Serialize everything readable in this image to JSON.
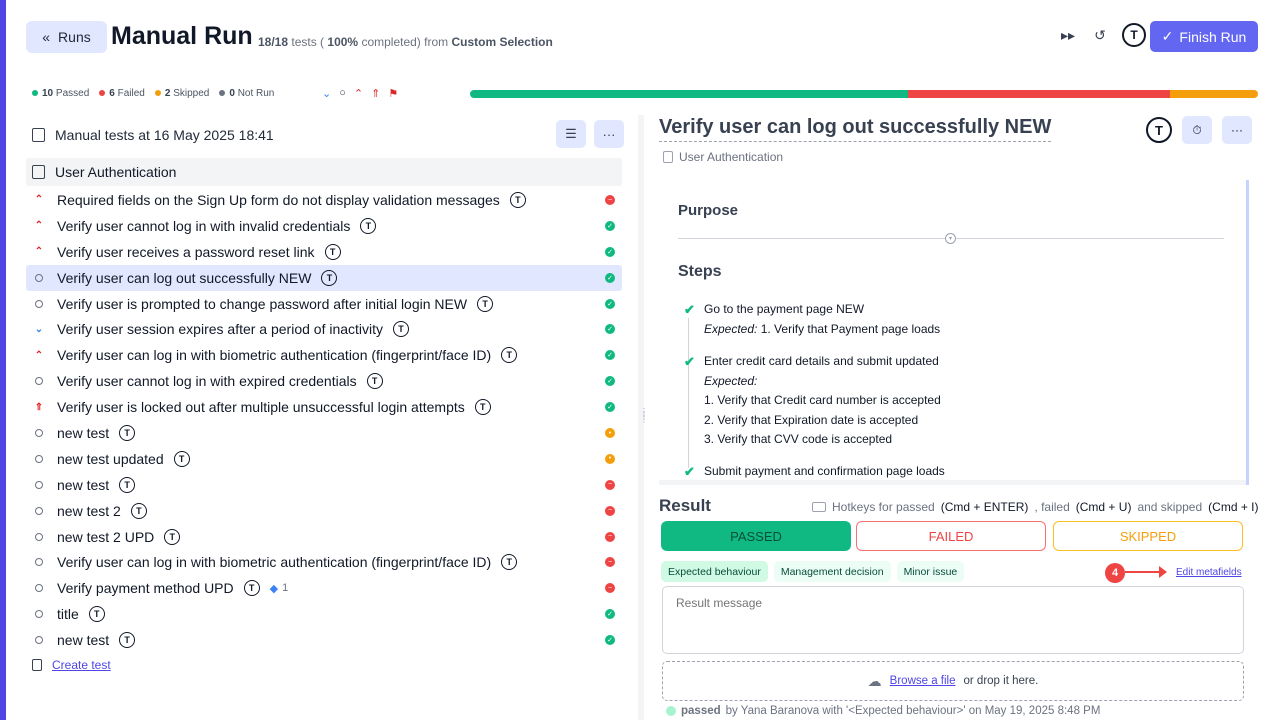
{
  "header": {
    "runs_label": "Runs",
    "title": "Manual Run",
    "summary_count": "18/18",
    "summary_tests": "tests (",
    "summary_percent": "100%",
    "summary_completed": "completed) from",
    "summary_source": "Custom Selection",
    "finish_label": "Finish Run"
  },
  "status": {
    "passed_count": "10",
    "passed_label": "Passed",
    "failed_count": "6",
    "failed_label": "Failed",
    "skipped_count": "2",
    "skipped_label": "Skipped",
    "notrun_count": "0",
    "notrun_label": "Not Run"
  },
  "progress": {
    "passed": 10,
    "failed": 6,
    "skipped": 2,
    "total": 18
  },
  "colors": {
    "passed": "#10b981",
    "failed": "#ef4444",
    "skipped": "#f59e0b",
    "accent": "#6366f1"
  },
  "left": {
    "header": "Manual tests at 16 May 2025 18:41",
    "suite": "User Authentication",
    "create_test": "Create test",
    "tests": [
      {
        "title": "Required fields on the Sign Up form do not display validation messages",
        "priority": "high",
        "status": "failed"
      },
      {
        "title": "Verify user cannot log in with invalid credentials",
        "priority": "high",
        "status": "passed"
      },
      {
        "title": "Verify user receives a password reset link",
        "priority": "high",
        "status": "passed"
      },
      {
        "title": "Verify user can log out successfully NEW",
        "priority": "normal",
        "status": "passed",
        "active": true
      },
      {
        "title": "Verify user is prompted to change password after initial login NEW",
        "priority": "normal",
        "status": "passed"
      },
      {
        "title": "Verify user session expires after a period of inactivity",
        "priority": "low",
        "status": "passed"
      },
      {
        "title": "Verify user can log in with biometric authentication (fingerprint/face ID)",
        "priority": "high",
        "status": "passed"
      },
      {
        "title": "Verify user cannot log in with expired credentials",
        "priority": "normal",
        "status": "passed"
      },
      {
        "title": "Verify user is locked out after multiple unsuccessful login attempts",
        "priority": "critical",
        "status": "passed"
      },
      {
        "title": "new test",
        "priority": "normal",
        "status": "skipped"
      },
      {
        "title": "new test updated",
        "priority": "normal",
        "status": "skipped"
      },
      {
        "title": "new test",
        "priority": "normal",
        "status": "failed"
      },
      {
        "title": "new test 2",
        "priority": "normal",
        "status": "failed"
      },
      {
        "title": "new test 2 UPD",
        "priority": "normal",
        "status": "failed"
      },
      {
        "title": "Verify user can log in with biometric authentication (fingerprint/face ID)",
        "priority": "normal",
        "status": "failed"
      },
      {
        "title": "Verify payment method UPD",
        "priority": "normal",
        "status": "failed",
        "jira": "1"
      },
      {
        "title": "title",
        "priority": "normal",
        "status": "passed"
      },
      {
        "title": "new test",
        "priority": "normal",
        "status": "passed"
      }
    ]
  },
  "detail": {
    "title": "Verify user can log out successfully NEW",
    "suite": "User Authentication",
    "purpose": "Purpose",
    "steps_title": "Steps",
    "steps": [
      {
        "text": "Go to the payment page NEW",
        "expected_label": "Expected:",
        "expected": [
          "1. Verify that Payment page loads"
        ]
      },
      {
        "text": "Enter credit card details and submit updated",
        "expected_label": "Expected:",
        "expected": [
          "1. Verify that Credit card number is accepted",
          "2. Verify that Expiration date is accepted",
          "3. Verify that CVV code is accepted"
        ]
      },
      {
        "text": "Submit payment and confirmation page loads"
      }
    ]
  },
  "result": {
    "label": "Result",
    "hotkeys_prefix": "Hotkeys for passed",
    "hotkey_pass": "(Cmd + ENTER)",
    "hotkeys_failed": ", failed",
    "hotkey_fail": "(Cmd + U)",
    "hotkeys_skipped": "and skipped",
    "hotkey_skip": "(Cmd + I)",
    "passed": "PASSED",
    "failed": "FAILED",
    "skipped": "SKIPPED",
    "tags": [
      "Expected behaviour",
      "Management decision",
      "Minor issue"
    ],
    "annotation": "4",
    "edit_metafields": "Edit metafields",
    "message_placeholder": "Result message",
    "browse": "Browse a file",
    "drop": "or drop it here.",
    "history_status": "passed",
    "history_by": "by Yana Baranova with '<Expected behaviour>' on May 19, 2025 8:48 PM"
  }
}
